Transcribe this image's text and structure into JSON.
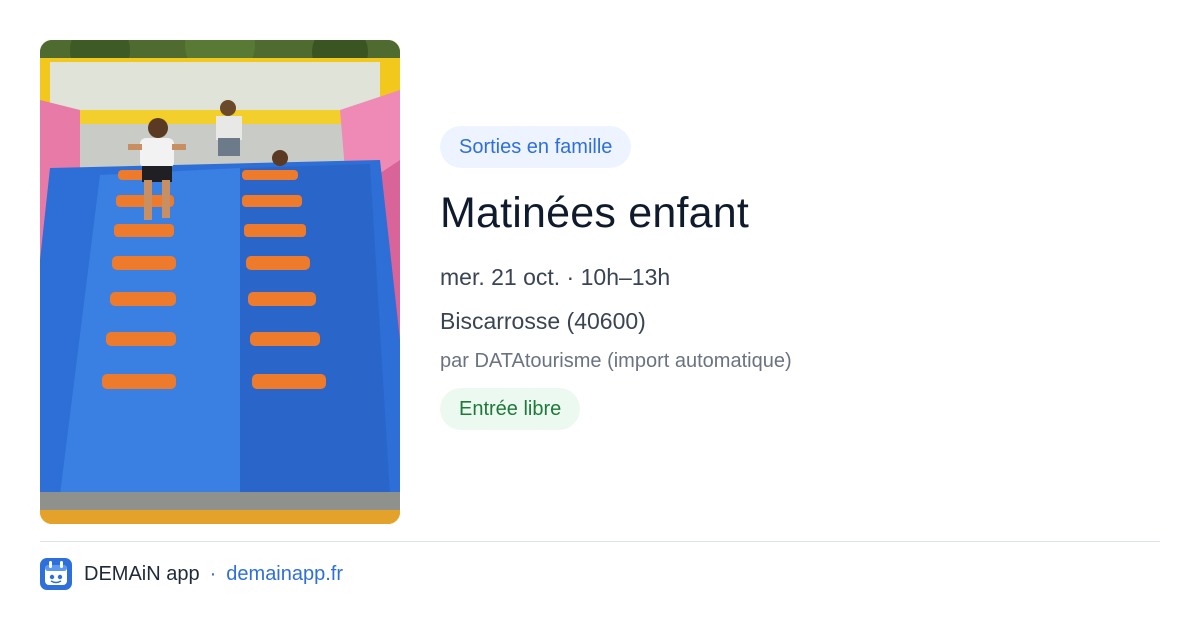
{
  "event": {
    "category": "Sorties en famille",
    "title": "Matinées enfant",
    "date_time": "mer. 21 oct. · 10h–13h",
    "location": "Biscarrosse (40600)",
    "source": "par DATAtourisme (import automatique)",
    "price": "Entrée libre"
  },
  "footer": {
    "app_name": "DEMAiN app",
    "separator": "·",
    "url": "demainapp.fr"
  },
  "colors": {
    "accent": "#2f6fd9",
    "category_chip_bg": "#eef4ff",
    "price_chip_bg": "#ecf9f0",
    "price_text": "#1f7a3a"
  },
  "icons": {
    "app_logo": "demain-app-logo-icon"
  }
}
